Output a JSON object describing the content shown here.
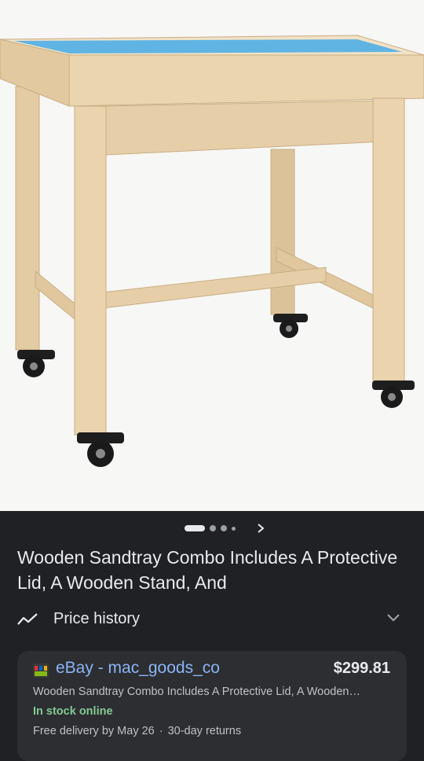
{
  "product": {
    "title": "Wooden Sandtray Combo Includes A Protective Lid, A Wooden Stand, And",
    "image_alt": "Wooden sandtray table with blue tray on caster wheels"
  },
  "carousel": {
    "active_index": 0,
    "total": 4
  },
  "price_history": {
    "label": "Price history",
    "icon": "trend-line-icon",
    "expand_icon": "chevron-down-icon"
  },
  "offer": {
    "seller": "eBay - mac_goods_co",
    "price": "$299.81",
    "description": "Wooden Sandtray Combo Includes A Protective Lid, A Wooden…",
    "stock": "In stock online",
    "delivery": "Free delivery by May 26",
    "separator": "·",
    "returns": "30-day returns"
  },
  "colors": {
    "background": "#202124",
    "card": "#2d2e31",
    "link": "#8ab4f8",
    "stock": "#81c995",
    "wood": "#e6cfa8",
    "tray": "#5fb4e4"
  }
}
